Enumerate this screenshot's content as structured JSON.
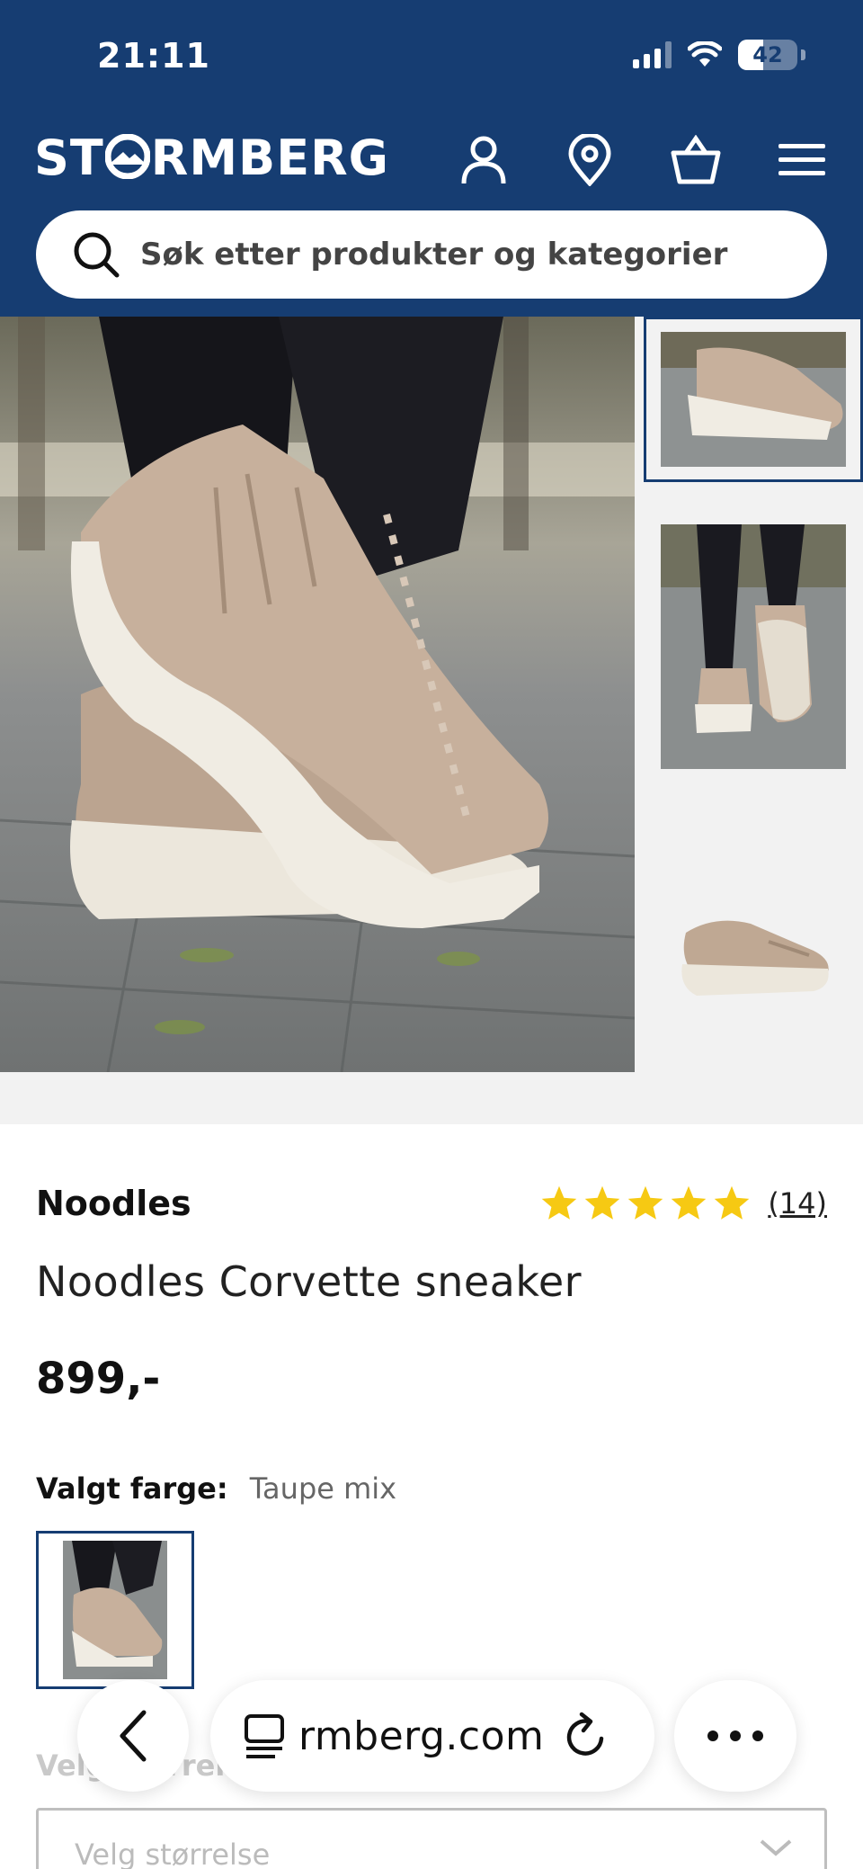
{
  "status_bar": {
    "time": "21:11",
    "battery": "42",
    "battery_level": 0.42
  },
  "header": {
    "logo_text": "STORMBERG",
    "logo_parts": {
      "before": "ST",
      "after": "RMBERG"
    },
    "icons": [
      "account-icon",
      "store-locator-icon",
      "cart-icon",
      "menu-icon"
    ]
  },
  "search": {
    "placeholder": "Søk etter produkter og kategorier"
  },
  "product": {
    "brand": "Noodles",
    "name": "Noodles Corvette sneaker",
    "price": "899,-",
    "rating_value": 5,
    "rating_max": 5,
    "review_count": "(14)",
    "selected_color_label": "Valgt farge:",
    "selected_color": "Taupe mix",
    "size_label": "Velg størrelse",
    "size_placeholder": "Velg størrelse"
  },
  "browser": {
    "url": "rmberg.com"
  },
  "colors": {
    "brand_blue": "#163d72",
    "star_yellow": "#f6c913"
  }
}
